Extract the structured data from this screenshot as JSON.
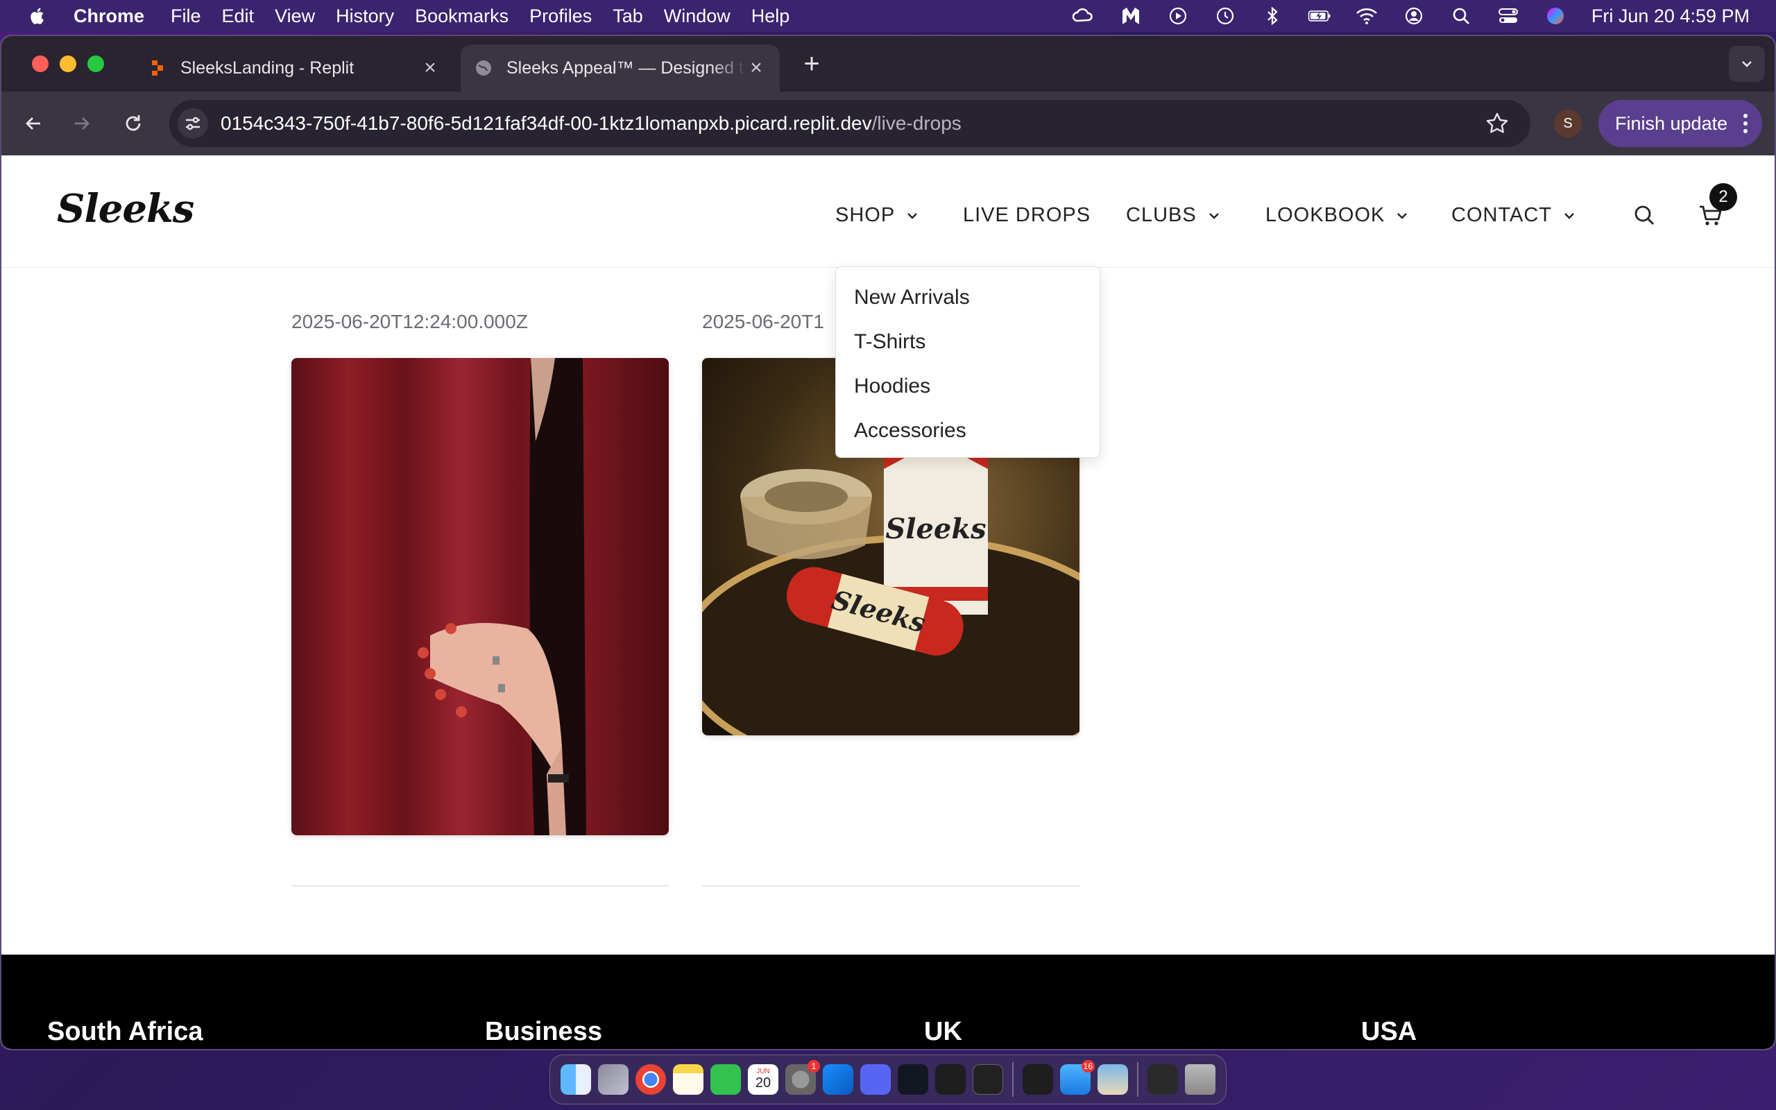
{
  "menubar": {
    "app_name": "Chrome",
    "items": [
      "File",
      "Edit",
      "View",
      "History",
      "Bookmarks",
      "Profiles",
      "Tab",
      "Window",
      "Help"
    ],
    "clock": "Fri Jun 20  4:59 PM",
    "status_icons": [
      "creative-cloud-icon",
      "malwarebytes-icon",
      "play-icon",
      "time-machine-icon",
      "bluetooth-icon",
      "battery-icon",
      "wifi-icon",
      "user-icon",
      "spotlight-icon",
      "control-center-icon",
      "siri-icon"
    ]
  },
  "browser": {
    "tabs": [
      {
        "title": "SleeksLanding - Replit",
        "active": false,
        "icon": "replit-icon"
      },
      {
        "title": "Sleeks Appeal™ — Designed t",
        "active": true,
        "icon": "globe-icon"
      }
    ],
    "url_host": "0154c343-750f-41b7-80f6-5d121faf34df-00-1ktz1lomanpxb.picard.replit.dev",
    "url_path": "/live-drops",
    "profile_initial": "S",
    "finish_update_label": "Finish update"
  },
  "site": {
    "logo": "Sleeks",
    "nav": {
      "shop": "SHOP",
      "live_drops": "LIVE DROPS",
      "clubs": "CLUBS",
      "lookbook": "LOOKBOOK",
      "contact": "CONTACT"
    },
    "cart_count": "2",
    "shop_menu": [
      "New Arrivals",
      "T-Shirts",
      "Hoodies",
      "Accessories"
    ],
    "drops": [
      {
        "date": "2025-06-20T12:24:00.000Z",
        "image": "woman-behind-red-curtain"
      },
      {
        "date": "2025-06-20T1",
        "image": "sleeks-lipstick-and-box-on-tray"
      }
    ],
    "footer_regions": [
      "South Africa",
      "Business",
      "UK",
      "USA"
    ]
  },
  "dock": {
    "apps": [
      "finder-icon",
      "launchpad-icon",
      "chrome-icon",
      "notes-icon",
      "facetime-icon",
      "calendar-icon",
      "system-settings-icon",
      "testflight-icon",
      "discord-icon",
      "tradingview-icon",
      "cube-app-icon",
      "terminal-icon",
      "cube-app-2-icon",
      "mail-icon",
      "preview-icon",
      "screen-capture-icon",
      "trash-icon"
    ],
    "calendar_day": "20",
    "calendar_month": "JUN",
    "settings_badge": "1",
    "mail_badge": "16"
  }
}
